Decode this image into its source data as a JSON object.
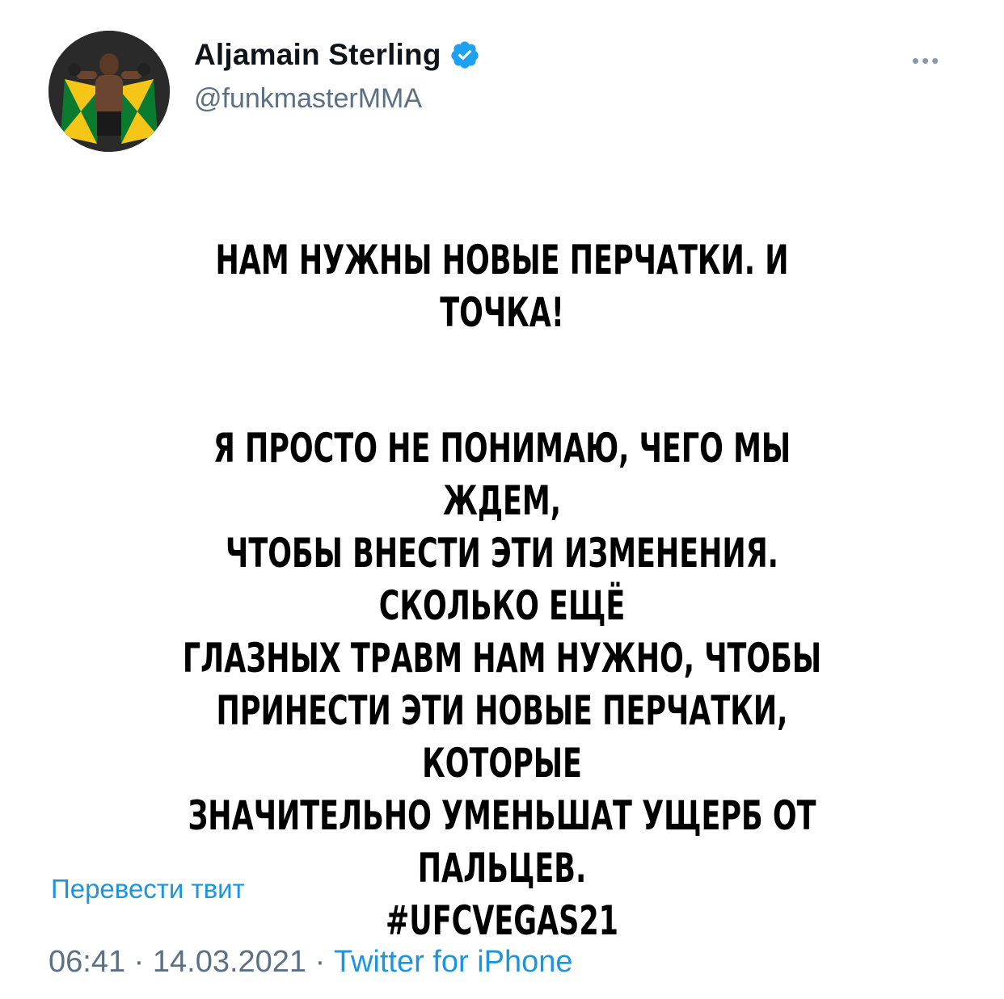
{
  "tweet": {
    "author": {
      "display_name": "Aljamain Sterling",
      "handle": "@funkmasterMMA",
      "verified": true,
      "avatar_icon": "avatar-photo"
    },
    "more_label": "•••",
    "body": {
      "line1": "НАМ НУЖНЫ НОВЫЕ ПЕРЧАТКИ. И ТОЧКА!",
      "paragraph2": "Я ПРОСТО НЕ ПОНИМАЮ, ЧЕГО МЫ ЖДЕМ,\nЧТОБЫ ВНЕСТИ ЭТИ ИЗМЕНЕНИЯ. СКОЛЬКО ЕЩЁ\nГЛАЗНЫХ ТРАВМ НАМ НУЖНО, ЧТОБЫ\nПРИНЕСТИ ЭТИ НОВЫЕ ПЕРЧАТКИ, КОТОРЫЕ\nЗНАЧИТЕЛЬНО УМЕНЬШАТ УЩЕРБ ОТ ПАЛЬЦЕВ.\n#UFCVEGAS21"
    },
    "translate_label": "Перевести твит",
    "time": "06:41",
    "separator": " · ",
    "date": "14.03.2021",
    "source": "Twitter for iPhone"
  },
  "colors": {
    "link": "#1b95e0",
    "secondary_text": "#5b7083",
    "verified_badge": "#1da1f2"
  }
}
